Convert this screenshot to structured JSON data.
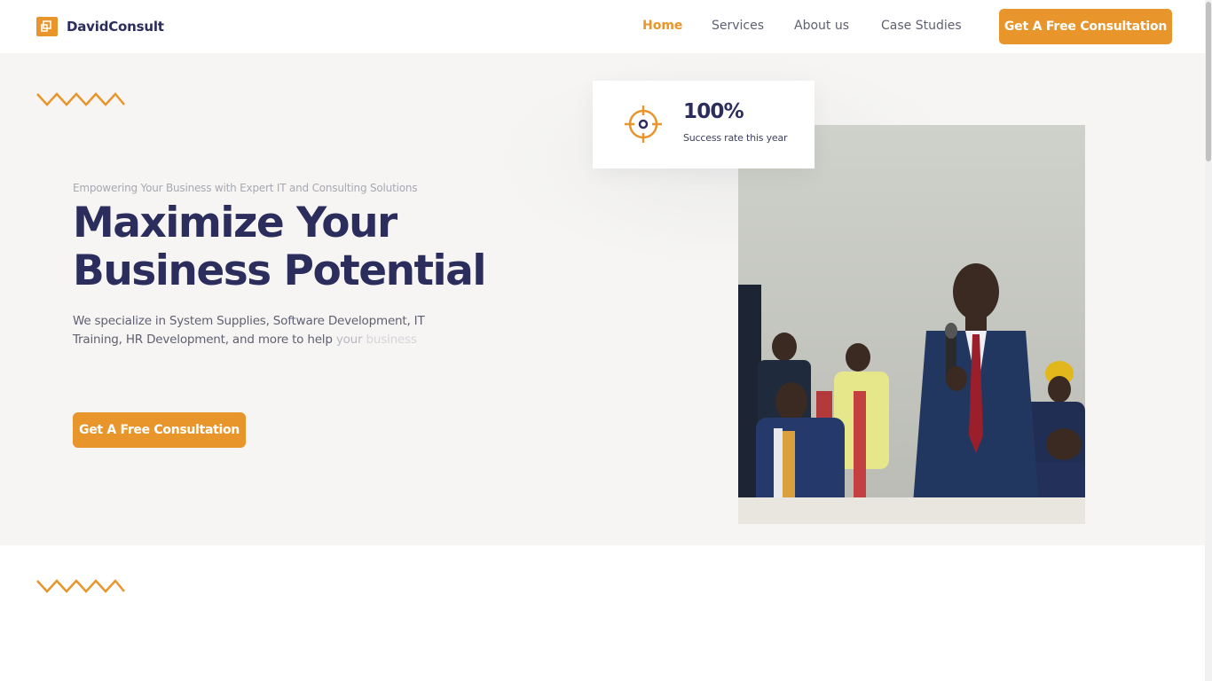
{
  "brand": {
    "name": "DavidConsult",
    "accent": "#e8952b",
    "dark": "#2b2d5c"
  },
  "nav": {
    "items": [
      {
        "label": "Home",
        "active": true
      },
      {
        "label": "Services",
        "active": false
      },
      {
        "label": "About us",
        "active": false
      },
      {
        "label": "Case Studies",
        "active": false
      }
    ],
    "cta": "Get A Free Consultation"
  },
  "hero": {
    "tagline": "Empowering Your Business with Expert IT and Consulting Solutions",
    "headline": "Maximize Your Business Potential",
    "description_main": "We specialize in System Supplies, Software Development, IT Training, HR Development, and more to help",
    "description_fade": "your",
    "description_fade2": "business",
    "cta": "Get A Free Consultation"
  },
  "stat": {
    "icon": "target-icon",
    "value": "100%",
    "label": "Success rate this year"
  },
  "photo": {
    "icon": "speaker-photo"
  }
}
